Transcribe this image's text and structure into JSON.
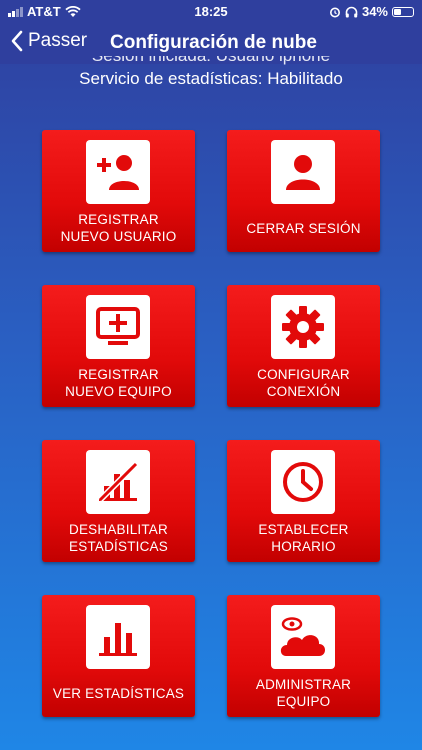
{
  "status_bar": {
    "carrier": "AT&T",
    "time": "18:25",
    "battery": "34%",
    "battery_level": 0.34,
    "icons": [
      "signal-icon",
      "wifi-icon",
      "alarm-icon",
      "headphones-icon",
      "battery-icon"
    ]
  },
  "nav": {
    "back_label": "Passer",
    "title": "Configuración de nube"
  },
  "session": {
    "user_line": "Sesión iniciada: Usuario iphone",
    "stats_line": "Servicio de estadísticas: Habilitado"
  },
  "colors": {
    "tile_red": "#e20a0a",
    "background_top": "#2f3f9e",
    "background_bottom": "#1f86e6"
  },
  "tiles": [
    {
      "label": "REGISTRAR\nNUEVO USUARIO",
      "icon": "add-user-icon"
    },
    {
      "label": "CERRAR SESIÓN",
      "icon": "user-icon"
    },
    {
      "label": "REGISTRAR\nNUEVO EQUIPO",
      "icon": "add-device-icon"
    },
    {
      "label": "CONFIGURAR\nCONEXIÓN",
      "icon": "gear-icon"
    },
    {
      "label": "DESHABILITAR\nESTADÍSTICAS",
      "icon": "disable-stats-icon"
    },
    {
      "label": "ESTABLECER\nHORARIO",
      "icon": "clock-icon"
    },
    {
      "label": "VER ESTADÍSTICAS",
      "icon": "bar-chart-icon"
    },
    {
      "label": "ADMINISTRAR\nEQUIPO",
      "icon": "cloud-device-icon"
    }
  ]
}
